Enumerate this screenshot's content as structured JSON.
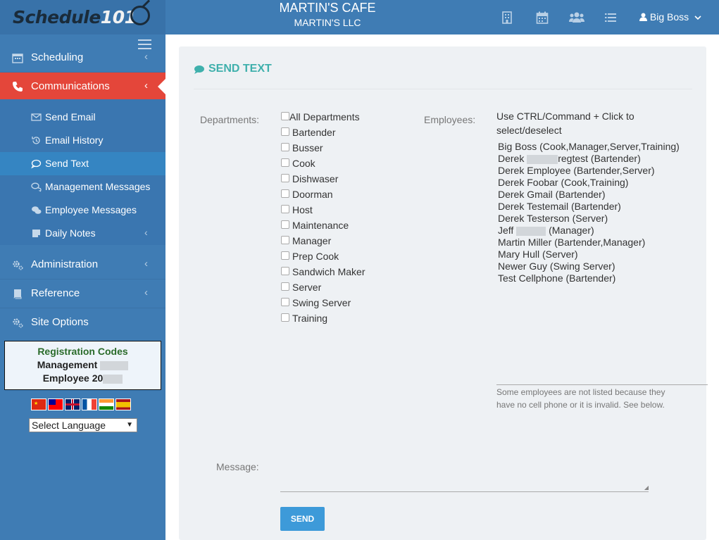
{
  "header": {
    "logo_text": "Schedule",
    "logo_number": "101",
    "business_name": "MARTIN'S CAFE",
    "company_name": "MARTIN'S LLC",
    "user_name": "Big Boss",
    "icons": [
      "building-icon",
      "calendar-icon",
      "users-icon",
      "list-icon"
    ],
    "accent_color": "#3f7cb4"
  },
  "sidebar": {
    "items": [
      {
        "label": "Scheduling",
        "icon": "calendar-icon"
      },
      {
        "label": "Communications",
        "icon": "phone-icon",
        "active": true
      },
      {
        "label": "Administration",
        "icon": "gears-icon"
      },
      {
        "label": "Reference",
        "icon": "book-icon"
      },
      {
        "label": "Site Options",
        "icon": "gears-icon"
      }
    ],
    "sub_items": [
      {
        "label": "Send Email",
        "icon": "envelope-icon"
      },
      {
        "label": "Email History",
        "icon": "history-icon"
      },
      {
        "label": "Send Text",
        "icon": "comment-icon",
        "active": true
      },
      {
        "label": "Management Messages",
        "icon": "comments-icon"
      },
      {
        "label": "Employee Messages",
        "icon": "comments-icon"
      },
      {
        "label": "Daily Notes",
        "icon": "note-icon"
      }
    ],
    "active_color": "#e4463a",
    "registration": {
      "title": "Registration Codes",
      "management_label": "Management",
      "employee_label": "Employee",
      "employee_code_visible": "20"
    },
    "language": {
      "selected": "Select Language",
      "flags": [
        "china-flag",
        "taiwan-flag",
        "uk-flag",
        "france-flag",
        "india-flag",
        "spain-flag"
      ]
    }
  },
  "send_text": {
    "title": "SEND TEXT",
    "departments_label": "Departments:",
    "departments": [
      "All Departments",
      "Bartender",
      "Busser",
      "Cook",
      "Dishwaser",
      "Doorman",
      "Host",
      "Maintenance",
      "Manager",
      "Prep Cook",
      "Sandwich Maker",
      "Server",
      "Swing Server",
      "Training"
    ],
    "employees_label": "Employees:",
    "employees_hint": "Use CTRL/Command + Click to select/deselect",
    "employees": [
      {
        "pre": "Big Boss (Cook,Manager,Server,Training)",
        "post": ""
      },
      {
        "pre": "Derek ",
        "post": "regtest (Bartender)",
        "redacted": true
      },
      {
        "pre": "Derek Employee (Bartender,Server)",
        "post": ""
      },
      {
        "pre": "Derek Foobar (Cook,Training)",
        "post": ""
      },
      {
        "pre": "Derek Gmail (Bartender)",
        "post": ""
      },
      {
        "pre": "Derek Testemail (Bartender)",
        "post": ""
      },
      {
        "pre": "Derek Testerson (Server)",
        "post": ""
      },
      {
        "pre": "Jeff ",
        "post": " (Manager)",
        "redacted": true
      },
      {
        "pre": "Martin Miller (Bartender,Manager)",
        "post": ""
      },
      {
        "pre": "Mary Hull (Server)",
        "post": ""
      },
      {
        "pre": "Newer Guy (Swing Server)",
        "post": ""
      },
      {
        "pre": "Test Cellphone (Bartender)",
        "post": ""
      }
    ],
    "employees_note": "Some employees are not listed because they have no cell phone or it is invalid. See below.",
    "message_label": "Message:",
    "message_value": "",
    "send_label": "SEND",
    "title_color": "#3fb0ac",
    "button_color": "#3d9ad9"
  }
}
